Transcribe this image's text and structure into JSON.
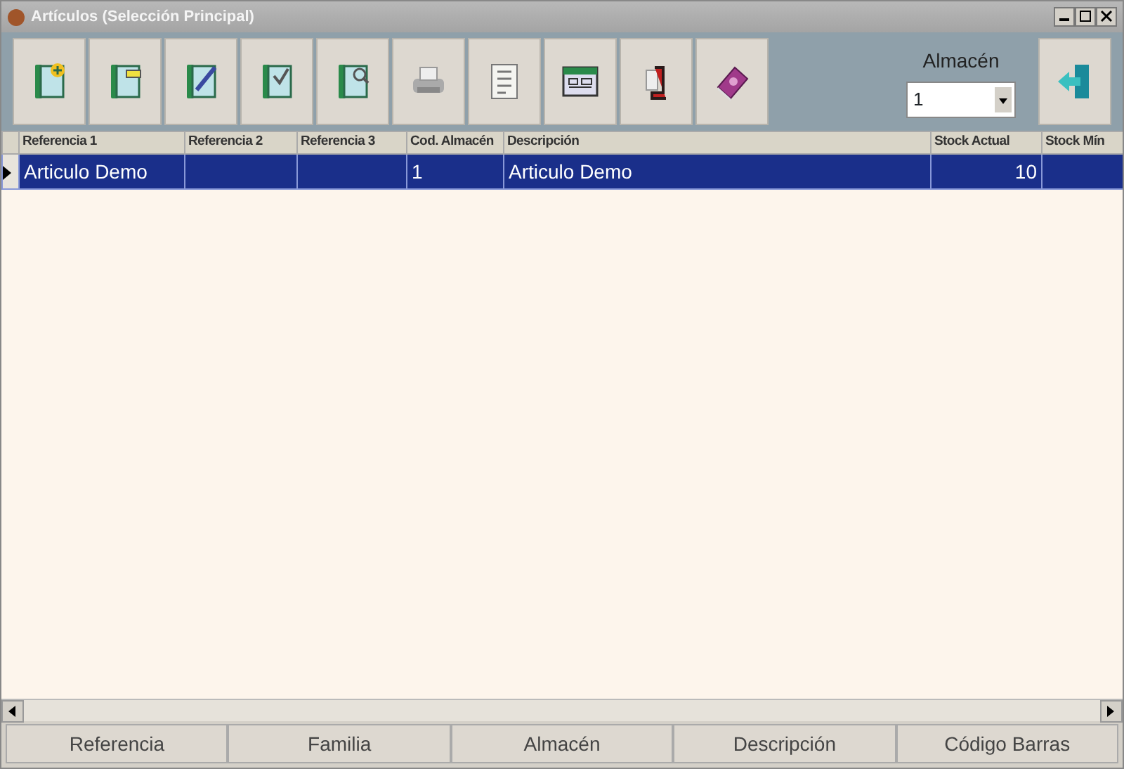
{
  "window": {
    "title": "Artículos (Selección Principal)"
  },
  "warehouse": {
    "label": "Almacén",
    "value": "1"
  },
  "table": {
    "columns": [
      "Referencia 1",
      "Referencia 2",
      "Referencia 3",
      "Cod. Almacén",
      "Descripción",
      "Stock Actual",
      "Stock Mín"
    ],
    "rows": [
      {
        "selected": true,
        "cells": [
          "Articulo Demo",
          "",
          "",
          "1",
          "Articulo Demo",
          "10",
          ""
        ]
      }
    ]
  },
  "search_buttons": [
    "Referencia",
    "Familia",
    "Almacén",
    "Descripción",
    "Código Barras"
  ]
}
